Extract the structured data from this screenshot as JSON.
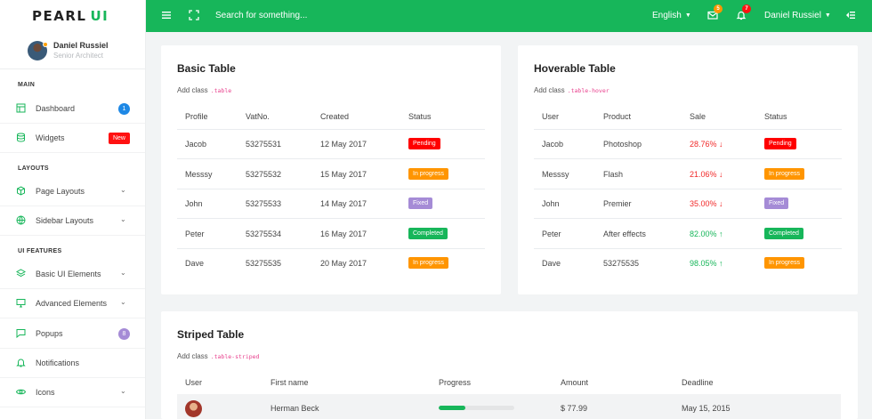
{
  "brand": {
    "name_left": "PEARL",
    "name_right": "UI"
  },
  "topbar": {
    "search_placeholder": "Search for something...",
    "language": "English",
    "mail_count": "5",
    "notif_count": "7",
    "user": "Daniel Russiel",
    "menu_icon": "hamburger-icon",
    "fullscreen_icon": "expand-icon",
    "mail_icon": "mail-icon",
    "bell_icon": "bell-icon",
    "collapse_icon": "collapse-icon"
  },
  "profile": {
    "name": "Daniel Russiel",
    "role": "Senior Architect"
  },
  "sidebar": {
    "sections": [
      "MAIN",
      "LAYOUTS",
      "UI FEATURES"
    ],
    "items": [
      {
        "label": "Dashboard",
        "icon": "layout-icon",
        "badge": "1"
      },
      {
        "label": "Widgets",
        "icon": "database-icon",
        "badge": "New"
      },
      {
        "label": "Page Layouts",
        "icon": "box-icon",
        "chevron": "⌄"
      },
      {
        "label": "Sidebar Layouts",
        "icon": "globe-icon",
        "chevron": "⌄"
      },
      {
        "label": "Basic UI Elements",
        "icon": "layers-icon",
        "chevron": "⌄"
      },
      {
        "label": "Advanced Elements",
        "icon": "monitor-icon",
        "chevron": "⌄"
      },
      {
        "label": "Popups",
        "icon": "message-icon",
        "badge": "8"
      },
      {
        "label": "Notifications",
        "icon": "bell-icon"
      },
      {
        "label": "Icons",
        "icon": "eye-icon",
        "chevron": "⌄"
      }
    ]
  },
  "basic_table": {
    "title": "Basic Table",
    "subtitle": "Add class",
    "class_name": ".table",
    "headers": [
      "Profile",
      "VatNo.",
      "Created",
      "Status"
    ],
    "rows": [
      {
        "profile": "Jacob",
        "vat": "53275531",
        "created": "12 May 2017",
        "status": "Pending"
      },
      {
        "profile": "Messsy",
        "vat": "53275532",
        "created": "15 May 2017",
        "status": "In progress"
      },
      {
        "profile": "John",
        "vat": "53275533",
        "created": "14 May 2017",
        "status": "Fixed"
      },
      {
        "profile": "Peter",
        "vat": "53275534",
        "created": "16 May 2017",
        "status": "Completed"
      },
      {
        "profile": "Dave",
        "vat": "53275535",
        "created": "20 May 2017",
        "status": "In progress"
      }
    ]
  },
  "hover_table": {
    "title": "Hoverable Table",
    "subtitle": "Add class",
    "class_name": ".table-hover",
    "headers": [
      "User",
      "Product",
      "Sale",
      "Status"
    ],
    "rows": [
      {
        "user": "Jacob",
        "product": "Photoshop",
        "sale": "28.76%",
        "trend": "↓",
        "status": "Pending"
      },
      {
        "user": "Messsy",
        "product": "Flash",
        "sale": "21.06%",
        "trend": "↓",
        "status": "In progress"
      },
      {
        "user": "John",
        "product": "Premier",
        "sale": "35.00%",
        "trend": "↓",
        "status": "Fixed"
      },
      {
        "user": "Peter",
        "product": "After effects",
        "sale": "82.00%",
        "trend": "↑",
        "status": "Completed"
      },
      {
        "user": "Dave",
        "product": "53275535",
        "sale": "98.05%",
        "trend": "↑",
        "status": "In progress"
      }
    ]
  },
  "striped_table": {
    "title": "Striped Table",
    "subtitle": "Add class",
    "class_name": ".table-striped",
    "headers": [
      "User",
      "First name",
      "Progress",
      "Amount",
      "Deadline"
    ],
    "rows": [
      {
        "first_name": "Herman Beck",
        "progress": 0.35,
        "amount": "$ 77.99",
        "deadline": "May 15, 2015"
      }
    ]
  },
  "colors": {
    "primary": "#17b65a",
    "danger": "#ff0000",
    "warning": "#ff9500",
    "info": "#a58bd6",
    "blue": "#1e88e5"
  }
}
